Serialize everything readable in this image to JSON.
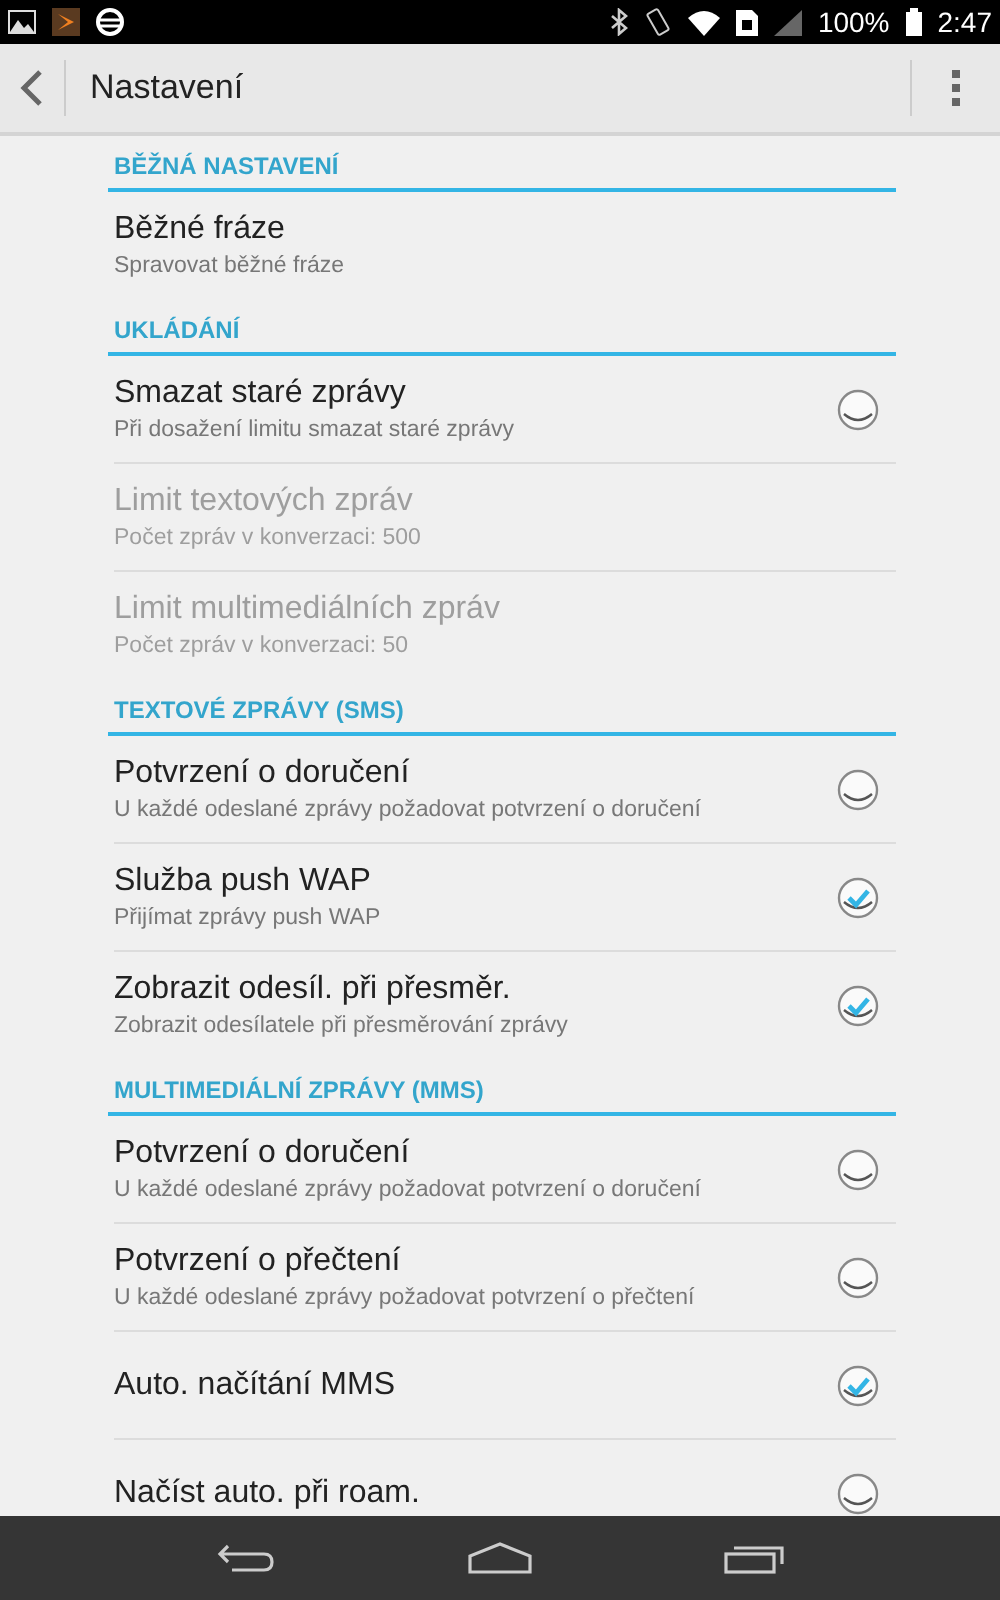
{
  "status_bar": {
    "battery": "100%",
    "time": "2:47"
  },
  "action_bar": {
    "title": "Nastavení"
  },
  "sections": [
    {
      "header": "BĚŽNÁ NASTAVENÍ",
      "items": [
        {
          "kind": "plain",
          "title": "Běžné fráze",
          "subtitle": "Spravovat běžné fráze",
          "disabled": false
        }
      ]
    },
    {
      "header": "UKLÁDÁNÍ",
      "items": [
        {
          "kind": "checkbox",
          "title": "Smazat staré zprávy",
          "subtitle": "Při dosažení limitu smazat staré zprávy",
          "checked": false,
          "disabled": false
        },
        {
          "kind": "plain",
          "title": "Limit textových zpráv",
          "subtitle": "Počet zpráv v konverzaci: 500",
          "disabled": true
        },
        {
          "kind": "plain",
          "title": "Limit multimediálních zpráv",
          "subtitle": "Počet zpráv v konverzaci: 50",
          "disabled": true
        }
      ]
    },
    {
      "header": "TEXTOVÉ ZPRÁVY (SMS)",
      "items": [
        {
          "kind": "checkbox",
          "title": "Potvrzení o doručení",
          "subtitle": "U každé odeslané zprávy požadovat potvrzení o doručení",
          "checked": false,
          "disabled": false
        },
        {
          "kind": "checkbox",
          "title": "Služba push WAP",
          "subtitle": "Přijímat zprávy push WAP",
          "checked": true,
          "disabled": false
        },
        {
          "kind": "checkbox",
          "title": "Zobrazit odesíl. při přesměr.",
          "subtitle": "Zobrazit odesílatele při přesměrování zprávy",
          "checked": true,
          "disabled": false
        }
      ]
    },
    {
      "header": "MULTIMEDIÁLNÍ ZPRÁVY (MMS)",
      "items": [
        {
          "kind": "checkbox",
          "title": "Potvrzení o doručení",
          "subtitle": "U každé odeslané zprávy požadovat potvrzení o doručení",
          "checked": false,
          "disabled": false
        },
        {
          "kind": "checkbox",
          "title": "Potvrzení o přečtení",
          "subtitle": "U každé odeslané zprávy požadovat potvrzení o přečtení",
          "checked": false,
          "disabled": false
        },
        {
          "kind": "checkbox",
          "title": "Auto. načítání MMS",
          "checked": true,
          "disabled": false
        },
        {
          "kind": "checkbox",
          "title": "Načíst auto. při roam.",
          "checked": false,
          "disabled": false
        }
      ]
    }
  ]
}
